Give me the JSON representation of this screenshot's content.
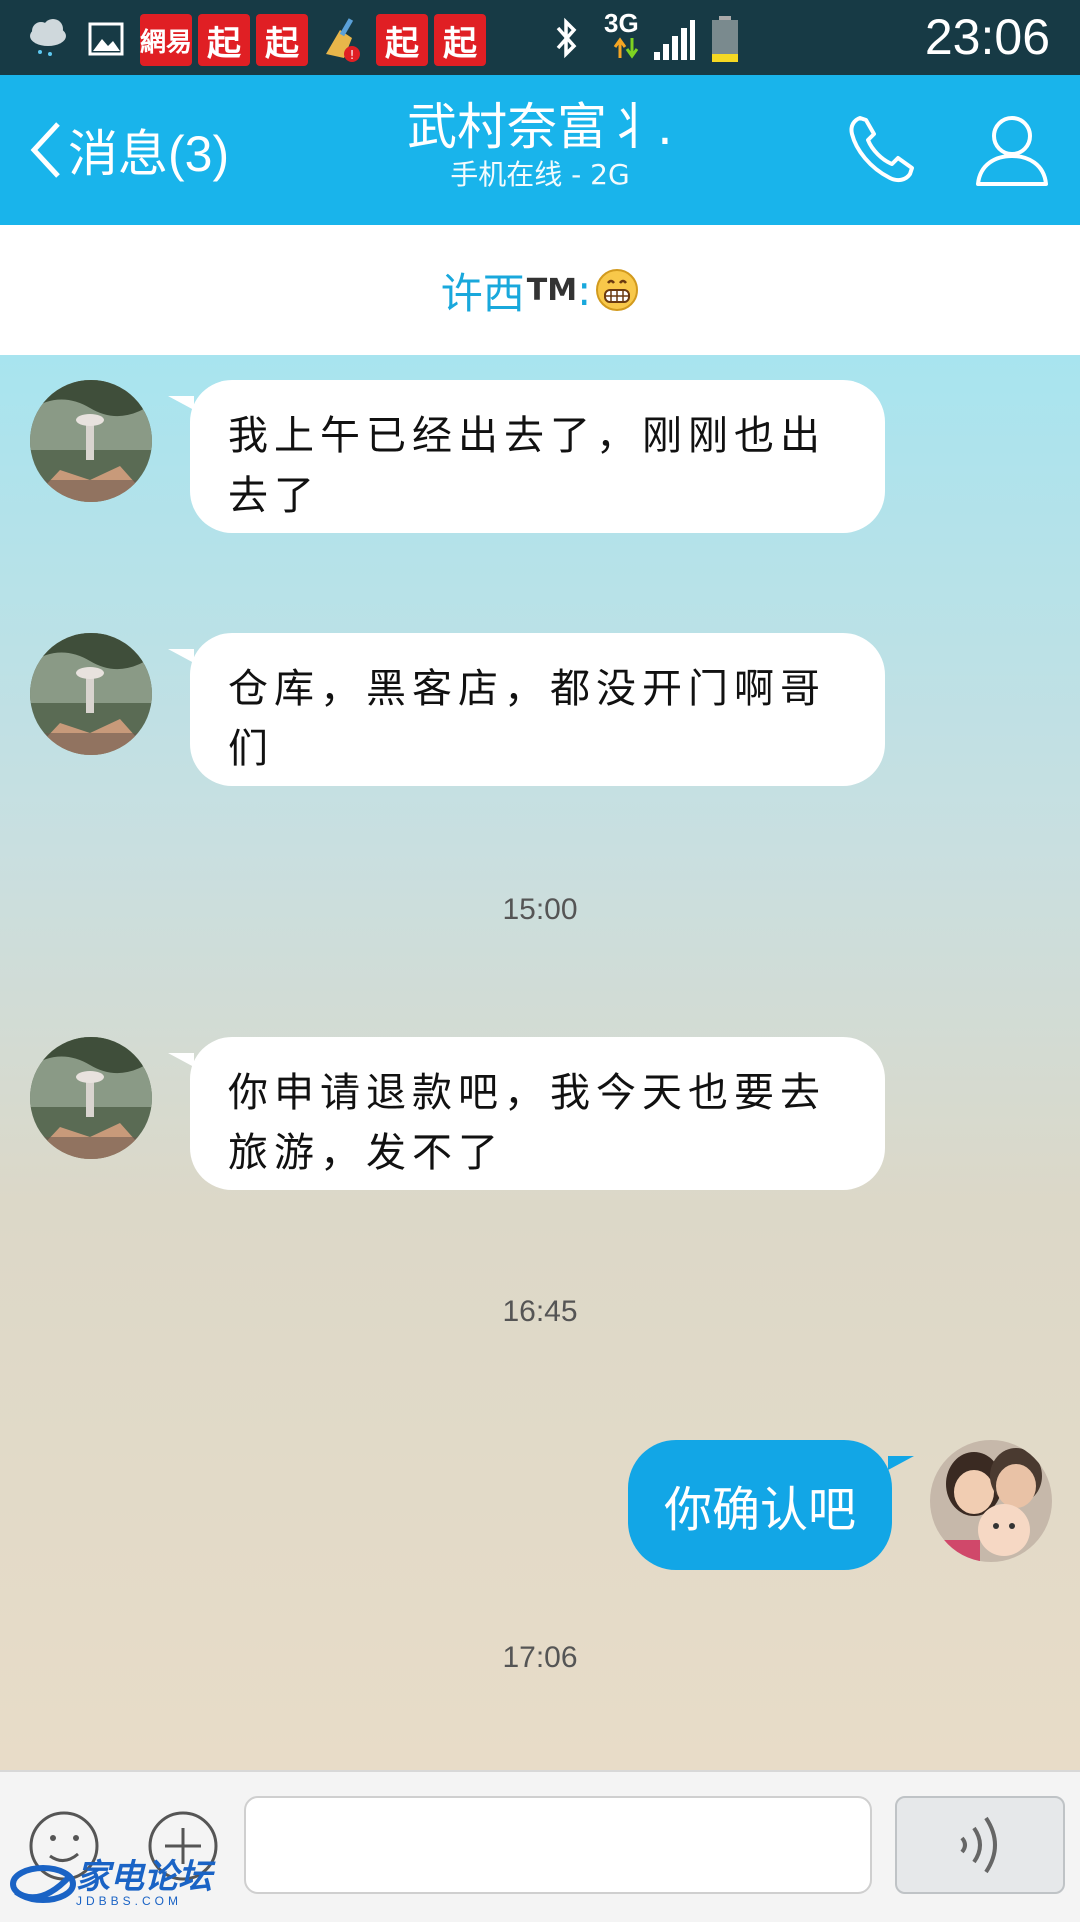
{
  "status_bar": {
    "time": "23:06",
    "network": "3G",
    "apps": [
      "網易",
      "起",
      "起",
      "起",
      "起"
    ]
  },
  "header": {
    "back_label": "消息(3)",
    "contact_name": "武村奈富丬.",
    "contact_status": "手机在线 - 2G"
  },
  "banner": {
    "name": "许西",
    "tm": "TM",
    "colon": ":"
  },
  "messages": [
    {
      "direction": "incoming",
      "text": "我上午已经出去了，刚刚也出去了"
    },
    {
      "direction": "incoming",
      "text": "仓库，黑客店，都没开门啊哥们"
    },
    {
      "type": "timestamp",
      "text": "15:00"
    },
    {
      "direction": "incoming",
      "text": "你申请退款吧，我今天也要去旅游，发不了"
    },
    {
      "type": "timestamp",
      "text": "16:45"
    },
    {
      "direction": "outgoing",
      "text": "你确认吧"
    },
    {
      "type": "timestamp",
      "text": "17:06"
    }
  ],
  "input": {
    "placeholder": ""
  },
  "watermark": {
    "brand": "家电论坛",
    "site": "JDBBS.COM"
  },
  "colors": {
    "header_bg": "#19b4eb",
    "status_bg": "#173a45",
    "outgoing_bubble": "#12a6e6",
    "banner_name": "#19a8dc"
  },
  "icons": [
    "weather-icon",
    "gallery-icon",
    "bluetooth-icon",
    "signal-icon",
    "battery-icon",
    "back-chevron-icon",
    "phone-icon",
    "profile-icon",
    "emoji-icon",
    "plus-icon",
    "voice-icon"
  ]
}
